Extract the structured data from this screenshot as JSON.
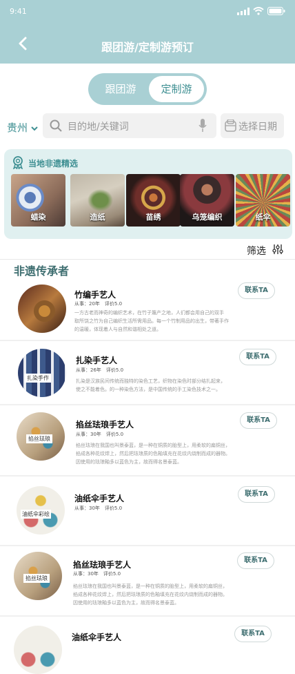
{
  "status": {
    "time": "9:41"
  },
  "header": {
    "title": "跟团游/定制游预订"
  },
  "segment": {
    "option1": "跟团游",
    "option2": "定制游",
    "selected": "定制游"
  },
  "search": {
    "region": "贵州",
    "placeholder": "目的地/关键词",
    "date_label": "选择日期"
  },
  "heritage": {
    "title": "当地非遗精选",
    "items": [
      {
        "label": "蜡染"
      },
      {
        "label": "造纸"
      },
      {
        "label": "苗绣"
      },
      {
        "label": "乌笼编织"
      },
      {
        "label": "纸伞"
      }
    ]
  },
  "filter": {
    "label": "筛选"
  },
  "section": {
    "title": "非遗传承者"
  },
  "artisans": [
    {
      "name": "竹编手艺人",
      "meta": "从事：20年　评价5.0",
      "desc1": "一方古老而神奇的编织艺术，在竹子篾产之地，人们都会用自己的双手",
      "desc2": "取所饶之竹为自己编织生活所需用品。每一个竹制用品的出生，带著手作",
      "desc3": "的温暖，体现着人与自然和谐相处之道。",
      "contact": "联系TA"
    },
    {
      "name": "扎染手艺人",
      "meta": "从事：26年　评价5.0",
      "desc1": "扎染是汉族民间传统而独特的染色工艺，织物在染色时部分结扎起来，",
      "desc2": "使之不能着色。的一种染色方法，是中国传统的手工染色技术之一。",
      "desc3": "",
      "contact": "联系TA"
    },
    {
      "name": "掐丝珐琅手艺人",
      "meta": "从事：30年　评价5.0",
      "desc1": "掐丝珐琅在我国也叫景泰蓝，是一种在铜质的胎型上，用柔软的扁铜丝，",
      "desc2": "掐成各种花纹焊上，然后把珐琅质的色釉填充在花纹内烧制而成的器物。",
      "desc3": "因使用的珐琅釉多以蓝色为主，故而得名景泰蓝。",
      "contact": "联系TA"
    },
    {
      "name": "油纸伞手艺人",
      "meta": "从事：30年　评价5.0",
      "desc1": "",
      "desc2": "",
      "desc3": "",
      "contact": "联系TA"
    },
    {
      "name": "掐丝珐琅手艺人",
      "meta": "从事：30年　评价5.0",
      "desc1": "掐丝珐琅在我国也叫景泰蓝，是一种在铜质的胎型上，用柔软的扁铜丝，",
      "desc2": "掐成各种花纹焊上，然后把珐琅质的色釉填充在花纹内烧制而成的器物。",
      "desc3": "因使用的珐琅釉多以蓝色为主，故而得名景泰蓝。",
      "contact": "联系TA"
    },
    {
      "name": "油纸伞手艺人",
      "meta": "",
      "desc1": "",
      "desc2": "",
      "desc3": "",
      "contact": "联系TA"
    }
  ],
  "avatar_captions": {
    "a2": "扎染手作",
    "a3": "掐丝珐琅",
    "a4": "油纸伞彩绘",
    "a5": "掐丝珐琅"
  },
  "colors": {
    "header_bg": "#a9d0d4",
    "accent": "#3e8f92",
    "section_title": "#3e6e70"
  }
}
